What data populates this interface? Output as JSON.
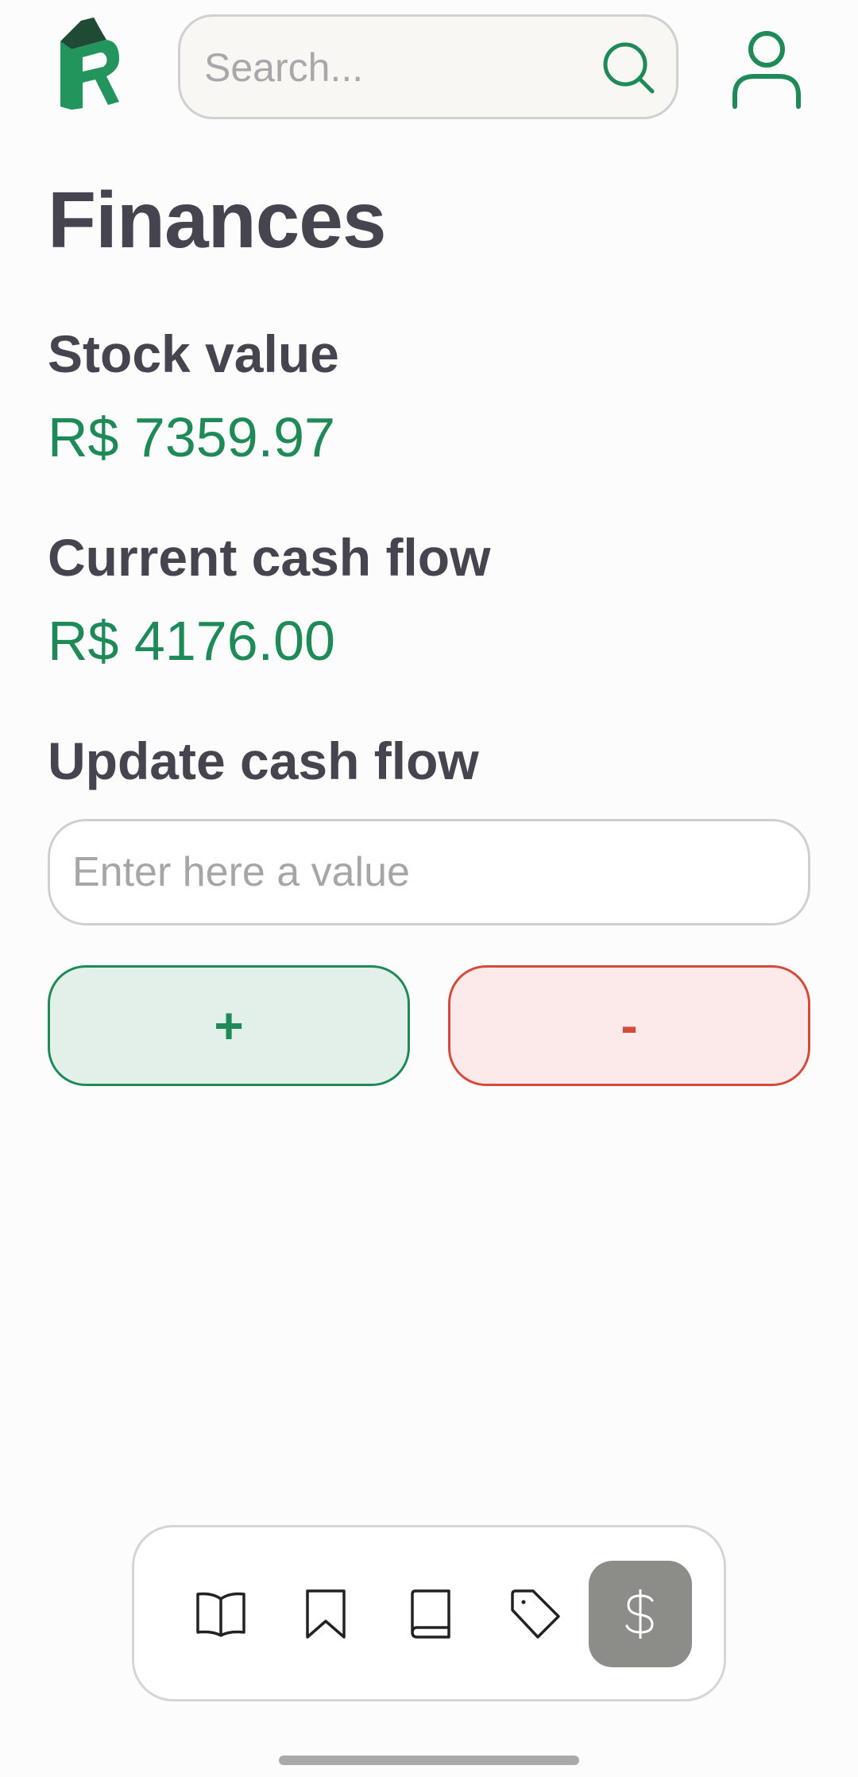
{
  "header": {
    "search_placeholder": "Search..."
  },
  "page": {
    "title": "Finances"
  },
  "stock": {
    "label": "Stock value",
    "value": "R$ 7359.97"
  },
  "cash_flow": {
    "label": "Current cash flow",
    "value": "R$ 4176.00"
  },
  "update": {
    "label": "Update cash flow",
    "placeholder": "Enter here a value",
    "add_label": "+",
    "subtract_label": "-"
  },
  "nav": {
    "items": [
      {
        "icon": "book-open-icon",
        "active": false
      },
      {
        "icon": "bookmark-icon",
        "active": false
      },
      {
        "icon": "book-icon",
        "active": false
      },
      {
        "icon": "tag-icon",
        "active": false
      },
      {
        "icon": "dollar-icon",
        "active": true
      }
    ]
  },
  "colors": {
    "brand_green": "#1e8a58",
    "danger_red": "#d44a3c",
    "text_dark": "#45444f",
    "nav_active": "#8c8d89"
  }
}
